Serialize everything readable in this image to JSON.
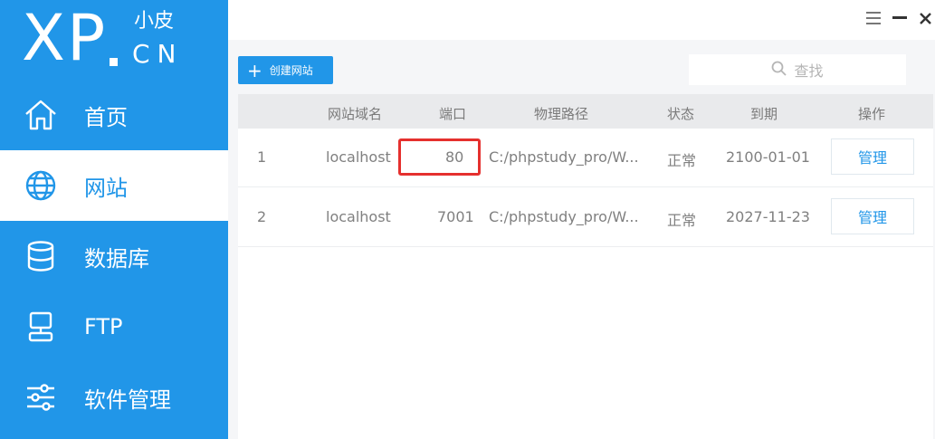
{
  "logo": {
    "brand": "XP",
    "small_text": "小皮",
    "suffix": "CN"
  },
  "sidebar": {
    "items": [
      {
        "label": "首页",
        "icon": "home-icon"
      },
      {
        "label": "网站",
        "icon": "globe-icon",
        "active": true
      },
      {
        "label": "数据库",
        "icon": "database-icon"
      },
      {
        "label": "FTP",
        "icon": "ftp-server-icon"
      },
      {
        "label": "软件管理",
        "icon": "sliders-icon"
      }
    ]
  },
  "window": {
    "controls": [
      "menu-icon",
      "minimize-icon",
      "close-icon"
    ]
  },
  "toolbar": {
    "create_label": "创建网站",
    "search_placeholder": "查找"
  },
  "table": {
    "headers": [
      "网站域名",
      "端口",
      "物理路径",
      "状态",
      "到期",
      "操作"
    ],
    "rows": [
      {
        "index": "1",
        "domain": "localhost",
        "port": "80",
        "path": "C:/phpstudy_pro/W...",
        "status": "正常",
        "expire": "2100-01-01",
        "action": "管理"
      },
      {
        "index": "2",
        "domain": "localhost",
        "port": "7001",
        "path": "C:/phpstudy_pro/W...",
        "status": "正常",
        "expire": "2027-11-23",
        "action": "管理"
      }
    ]
  },
  "colors": {
    "primary": "#2196e8",
    "highlight": "#e5302e",
    "text_muted": "#808080",
    "header_bg": "#e9eaec"
  }
}
